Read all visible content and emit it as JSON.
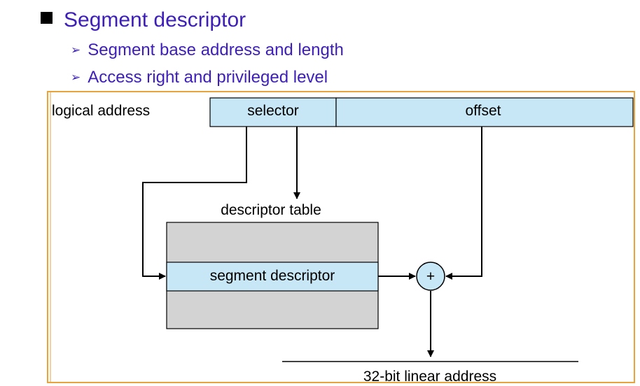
{
  "bullets": {
    "main": "Segment descriptor",
    "sub": [
      "Segment base address and length",
      "Access right and privileged level"
    ]
  },
  "diagram": {
    "logical_address_label": "logical address",
    "selector_label": "selector",
    "offset_label": "offset",
    "descriptor_table_label": "descriptor table",
    "segment_descriptor_label": "segment descriptor",
    "adder_symbol": "+",
    "linear_address_label": "32-bit linear address"
  },
  "colors": {
    "bullet_text": "#3d1fb8",
    "frame": "#e8a33d",
    "field_fill": "#c7e6f6",
    "table_fill": "#d3d3d3"
  }
}
